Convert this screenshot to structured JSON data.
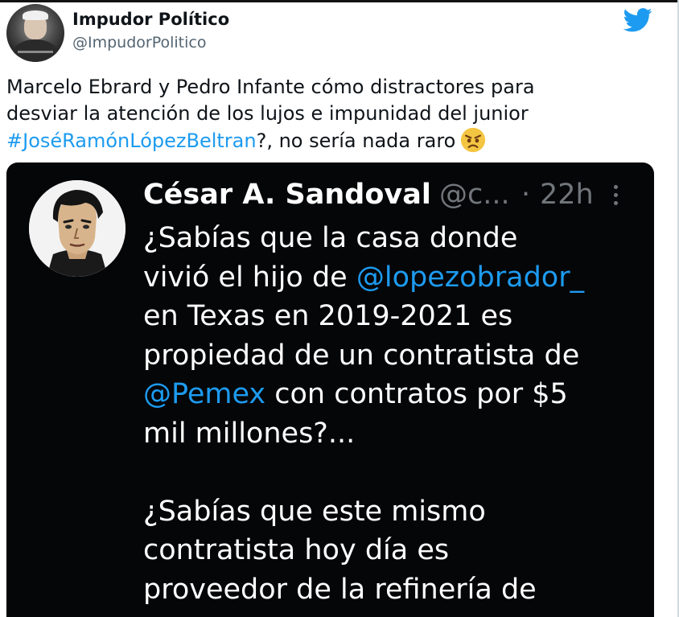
{
  "tweet": {
    "author": {
      "display_name": "Impudor Político",
      "handle": "@ImpudorPolitico"
    },
    "brand_icon": "twitter-bird-icon",
    "text_segments": {
      "line1": "Marcelo Ebrard y Pedro Infante cómo distractores para",
      "line2": "desviar la atención de los lujos e impunidad del junior",
      "hashtag": "#JoséRamónLópezBeltran",
      "after_hashtag": "?, no sería nada raro",
      "emoji": "angry-face-emoji"
    }
  },
  "quoted_tweet": {
    "author": {
      "display_name": "César A. Sandoval",
      "handle": "@c...",
      "separator": "·",
      "time": "22h"
    },
    "more_icon": "more-vertical-icon",
    "body": {
      "l1": "¿Sabías que la casa donde",
      "l2_pre": "vivió el hijo de ",
      "l2_mention": "@lopezobrador_",
      "l3": "en Texas en 2019-2021 es",
      "l4": "propiedad de un contratista de",
      "l5_mention": "@Pemex",
      "l5_post": " con contratos por $5",
      "l6": "mil millones?...",
      "l8": "¿Sabías que este mismo",
      "l9": "contratista hoy día es",
      "l10": "proveedor de la refinería de"
    }
  },
  "colors": {
    "link_blue": "#1d9bf0",
    "twitter_blue": "#1d9bf0",
    "quote_background": "#050608",
    "muted_text": "#71767b"
  }
}
